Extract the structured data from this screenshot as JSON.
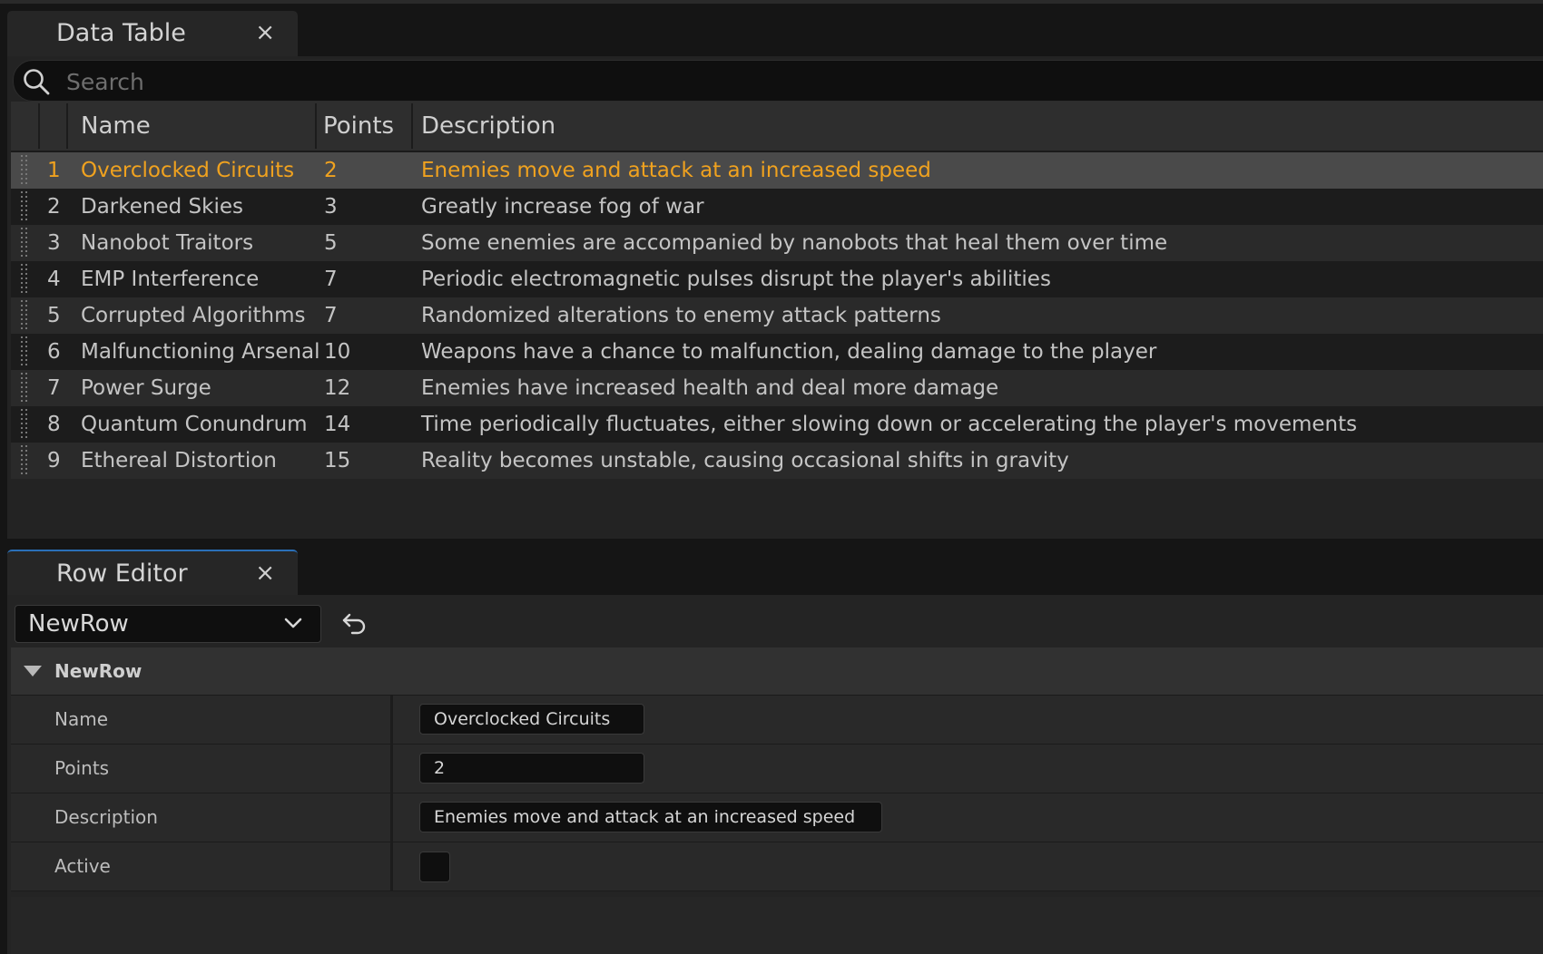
{
  "data_table": {
    "tab_title": "Data Table",
    "close_glyph": "×",
    "search": {
      "placeholder": "Search",
      "value": ""
    },
    "columns": [
      "Name",
      "Points",
      "Description"
    ],
    "rows": [
      {
        "index": "1",
        "name": "Overclocked Circuits",
        "points": "2",
        "description": "Enemies move and attack at an increased speed"
      },
      {
        "index": "2",
        "name": "Darkened Skies",
        "points": "3",
        "description": "Greatly increase fog of war"
      },
      {
        "index": "3",
        "name": "Nanobot Traitors",
        "points": "5",
        "description": "Some enemies are accompanied by nanobots that heal them over time"
      },
      {
        "index": "4",
        "name": "EMP Interference",
        "points": "7",
        "description": "Periodic electromagnetic pulses disrupt the player's abilities"
      },
      {
        "index": "5",
        "name": "Corrupted Algorithms",
        "points": "7",
        "description": "Randomized alterations to enemy attack patterns"
      },
      {
        "index": "6",
        "name": "Malfunctioning Arsenal",
        "points": "10",
        "description": "Weapons have a chance to malfunction, dealing damage to the player"
      },
      {
        "index": "7",
        "name": "Power Surge",
        "points": "12",
        "description": "Enemies have increased health and deal more damage"
      },
      {
        "index": "8",
        "name": "Quantum Conundrum",
        "points": "14",
        "description": "Time periodically fluctuates, either slowing down or accelerating the player's movements"
      },
      {
        "index": "9",
        "name": "Ethereal Distortion",
        "points": "15",
        "description": "Reality becomes unstable, causing occasional shifts in gravity"
      }
    ],
    "selected_row": 0
  },
  "row_editor": {
    "tab_title": "Row Editor",
    "close_glyph": "×",
    "row_select_value": "NewRow",
    "category_title": "NewRow",
    "properties": {
      "name_label": "Name",
      "name_value": "Overclocked Circuits",
      "points_label": "Points",
      "points_value": "2",
      "description_label": "Description",
      "description_value": "Enemies move and attack at an increased speed",
      "active_label": "Active",
      "active_checked": false
    }
  },
  "colors": {
    "selected_text": "#f0a21f",
    "selected_row_bg": "#4a4a4a",
    "active_tab_accent": "#2a6fb8"
  },
  "icons": [
    "search-icon",
    "close-icon",
    "chevron-down-icon",
    "undo-icon",
    "drag-handle-icon",
    "collapse-arrow-icon"
  ]
}
